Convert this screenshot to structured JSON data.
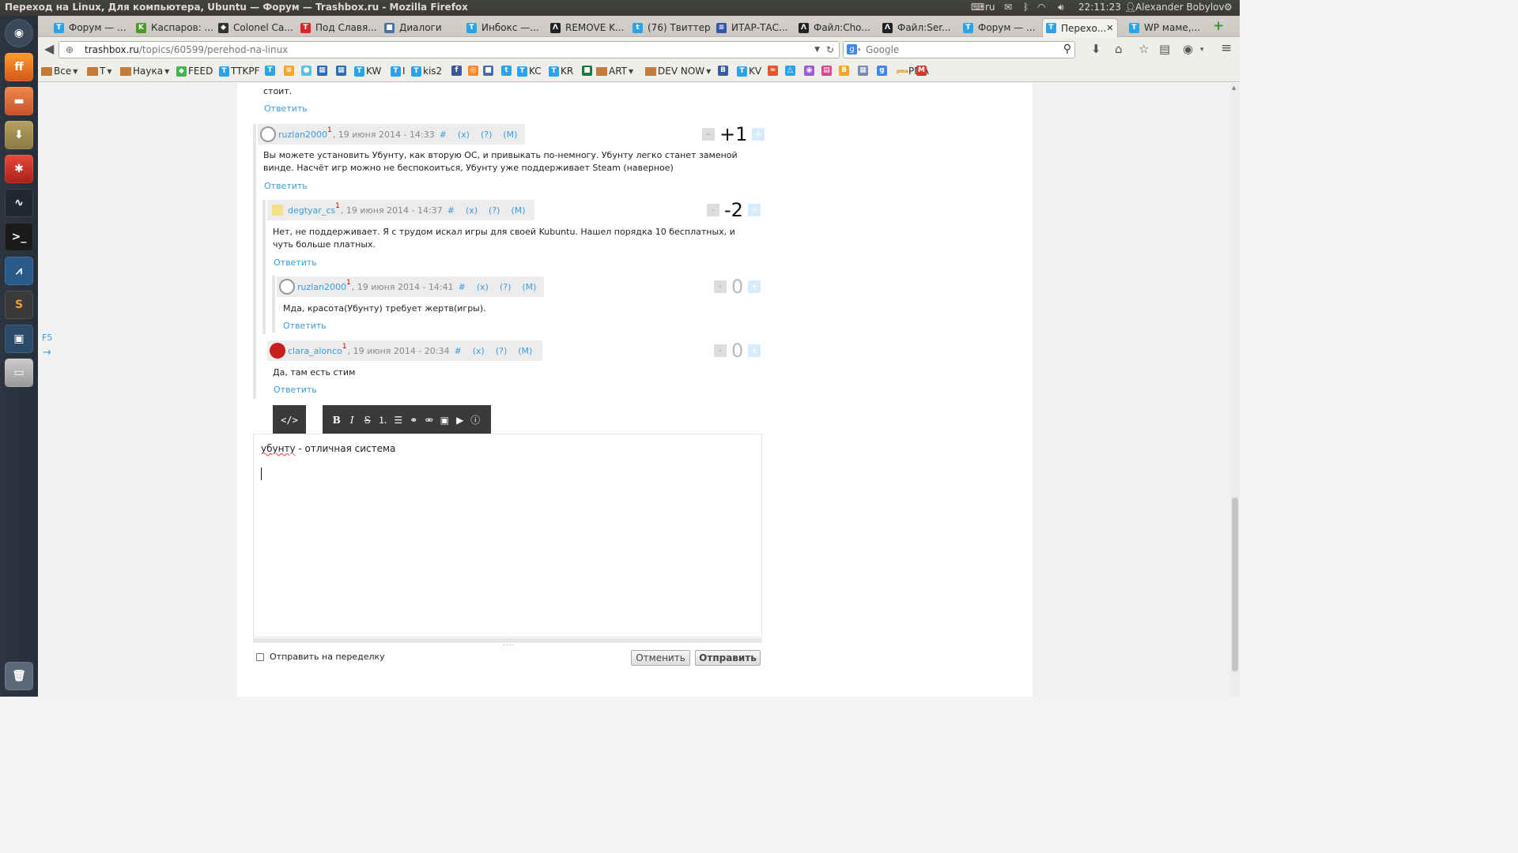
{
  "window": {
    "title": "Переход на Linux, Для компьютера, Ubuntu — Форум — Trashbox.ru - Mozilla Firefox",
    "keyboard_layout": "ru",
    "clock": "22:11:23",
    "user": "Alexander Bobylov"
  },
  "tabs": [
    {
      "label": "Форум — ...",
      "icon": "trashbox-icon",
      "color": "#2aa3e8",
      "glyph": "T"
    },
    {
      "label": "Каспаров: ...",
      "icon": "kasparov-icon",
      "color": "#4a9a2a",
      "glyph": "K"
    },
    {
      "label": "Colonel Ca...",
      "icon": "colonel-icon",
      "color": "#333333",
      "glyph": "◆"
    },
    {
      "label": "Под Славя...",
      "icon": "t-red-icon",
      "color": "#d8262d",
      "glyph": "T"
    },
    {
      "label": "Диалоги",
      "icon": "dialog-icon",
      "color": "#4a6fa5",
      "glyph": "■"
    },
    {
      "label": "Инбокс —...",
      "icon": "trashbox-icon",
      "color": "#2aa3e8",
      "glyph": "T"
    },
    {
      "label": "REMOVE K...",
      "icon": "lambda-icon",
      "color": "#222222",
      "glyph": "Λ"
    },
    {
      "label": "(76) Твиттер",
      "icon": "twitter-icon",
      "color": "#2aa3e8",
      "glyph": "t"
    },
    {
      "label": "ИТАР-ТАС...",
      "icon": "itar-icon",
      "color": "#3355aa",
      "glyph": "≡"
    },
    {
      "label": "Файл:Cho...",
      "icon": "lambda-icon",
      "color": "#222222",
      "glyph": "Λ"
    },
    {
      "label": "Файл:Ser...",
      "icon": "lambda-icon",
      "color": "#222222",
      "glyph": "Λ"
    },
    {
      "label": "Форум — ...",
      "icon": "trashbox-icon",
      "color": "#2aa3e8",
      "glyph": "T"
    },
    {
      "label": "Перехо...",
      "icon": "trashbox-icon",
      "color": "#2aa3e8",
      "glyph": "T",
      "active": true
    },
    {
      "label": "WP маме,...",
      "icon": "trashbox-icon",
      "color": "#2aa3e8",
      "glyph": "T"
    }
  ],
  "navbar": {
    "url_host": "trashbox.ru",
    "url_path": "/topics/60599/perehod-na-linux",
    "search_placeholder": "Google"
  },
  "bookmarks": [
    {
      "label": "Все",
      "type": "folder",
      "menu": true
    },
    {
      "label": "T",
      "type": "folder",
      "menu": true
    },
    {
      "label": "Наука",
      "type": "folder",
      "menu": true
    },
    {
      "label": "FEED",
      "type": "icon",
      "color": "#3cb84a",
      "glyph": "◆"
    },
    {
      "label": "TTKPF",
      "type": "icon",
      "color": "#2aa3e8",
      "glyph": "T"
    },
    {
      "label": "",
      "type": "icon",
      "color": "#2aa3e8",
      "glyph": "T"
    },
    {
      "label": "",
      "type": "icon",
      "color": "#f5a623",
      "glyph": "≡"
    },
    {
      "label": "",
      "type": "icon",
      "color": "#5bc0de",
      "glyph": "●"
    },
    {
      "label": "",
      "type": "icon",
      "color": "#2a6fb5",
      "glyph": "▦"
    },
    {
      "label": "",
      "type": "icon",
      "color": "#2a6fb5",
      "glyph": "▦"
    },
    {
      "label": "KW",
      "type": "icon",
      "color": "#2aa3e8",
      "glyph": "T"
    },
    {
      "label": "I",
      "type": "icon",
      "color": "#2aa3e8",
      "glyph": "T"
    },
    {
      "label": "kis2",
      "type": "icon",
      "color": "#2aa3e8",
      "glyph": "T"
    },
    {
      "label": "",
      "type": "icon",
      "color": "#3b5998",
      "glyph": "f"
    },
    {
      "label": "",
      "type": "icon",
      "color": "#f5892b",
      "glyph": "◎"
    },
    {
      "label": "",
      "type": "icon",
      "color": "#4a6fa5",
      "glyph": "■"
    },
    {
      "label": "",
      "type": "icon",
      "color": "#2aa3e8",
      "glyph": "t"
    },
    {
      "label": "KC",
      "type": "icon",
      "color": "#2aa3e8",
      "glyph": "T"
    },
    {
      "label": "KR",
      "type": "icon",
      "color": "#2aa3e8",
      "glyph": "T"
    },
    {
      "label": "",
      "type": "icon",
      "color": "#1a7a3a",
      "glyph": "■"
    },
    {
      "label": "ART",
      "type": "folder",
      "menu": true
    },
    {
      "label": "DEV NOW",
      "type": "folder",
      "menu": true
    },
    {
      "label": "",
      "type": "icon",
      "color": "#3a5ba0",
      "glyph": "B"
    },
    {
      "label": "KV",
      "type": "icon",
      "color": "#2aa3e8",
      "glyph": "T"
    },
    {
      "label": "",
      "type": "icon",
      "color": "#e8562a",
      "glyph": "≈"
    },
    {
      "label": "",
      "type": "icon",
      "color": "#2aa3e8",
      "glyph": "△"
    },
    {
      "label": "",
      "type": "icon",
      "color": "#a05bd6",
      "glyph": "◉"
    },
    {
      "label": "",
      "type": "icon",
      "color": "#d44a8a",
      "glyph": "▤"
    },
    {
      "label": "",
      "type": "icon",
      "color": "#f5a623",
      "glyph": "B"
    },
    {
      "label": "",
      "type": "icon",
      "color": "#7a8ab0",
      "glyph": "▦"
    },
    {
      "label": "",
      "type": "icon",
      "color": "#4285f4",
      "glyph": "g"
    },
    {
      "label": "PMA",
      "type": "icon",
      "color": "#e08a00",
      "glyph": "pma"
    },
    {
      "label": "",
      "type": "icon",
      "color": "#d23a2a",
      "glyph": "M"
    }
  ],
  "page": {
    "side_f5": "F5",
    "side_arrow": "→",
    "prev_text_tail": "стоит.",
    "reply_label": "Ответить"
  },
  "comments": [
    {
      "user": "ruzlan2000",
      "level": "1",
      "date": "19 июня 2014 - 14:33",
      "hash": "#",
      "x": "(x)",
      "q": "(?)",
      "m": "(M)",
      "score": "+1",
      "text": "Вы можете установить Убунту, как вторую ОС, и привыкать по-немногу. Убунту легко станет заменой винде. Насчёт игр можно не беспокоиться, Убунту уже поддерживает Steam (наверное)"
    },
    {
      "user": "degtyar_cs",
      "level": "1",
      "date": "19 июня 2014 - 14:37",
      "hash": "#",
      "x": "(x)",
      "q": "(?)",
      "m": "(M)",
      "score": "-2",
      "text": "Нет, не поддерживает. Я с трудом искал игры для своей Kubuntu. Нашел порядка 10 бесплатных, и чуть больше платных."
    },
    {
      "user": "ruzlan2000",
      "level": "1",
      "date": "19 июня 2014 - 14:41",
      "hash": "#",
      "x": "(x)",
      "q": "(?)",
      "m": "(M)",
      "score": "0",
      "text": "Мда, красота(Убунту) требует жертв(игры)."
    },
    {
      "user": "clara_alonco",
      "level": "1",
      "date": "19 июня 2014 - 20:34",
      "hash": "#",
      "x": "(x)",
      "q": "(?)",
      "m": "(M)",
      "score": "0",
      "text": "Да, там есть стим"
    }
  ],
  "vote": {
    "minus": "-",
    "plus": "+"
  },
  "editor": {
    "code_label": "</>",
    "tools": [
      "B",
      "I",
      "S",
      "ol",
      "ul",
      "link",
      "unlink",
      "image",
      "play",
      "info"
    ],
    "text_misspelled": "убунту",
    "text_rest": " - отличная система",
    "grip": "....",
    "rework_label": "Отправить на переделку",
    "cancel_label": "Отменить",
    "submit_label": "Отправить"
  },
  "colors": {
    "link": "#3a9be0",
    "accent": "#2aa3e8",
    "toolbar": "#3a3a3a"
  }
}
